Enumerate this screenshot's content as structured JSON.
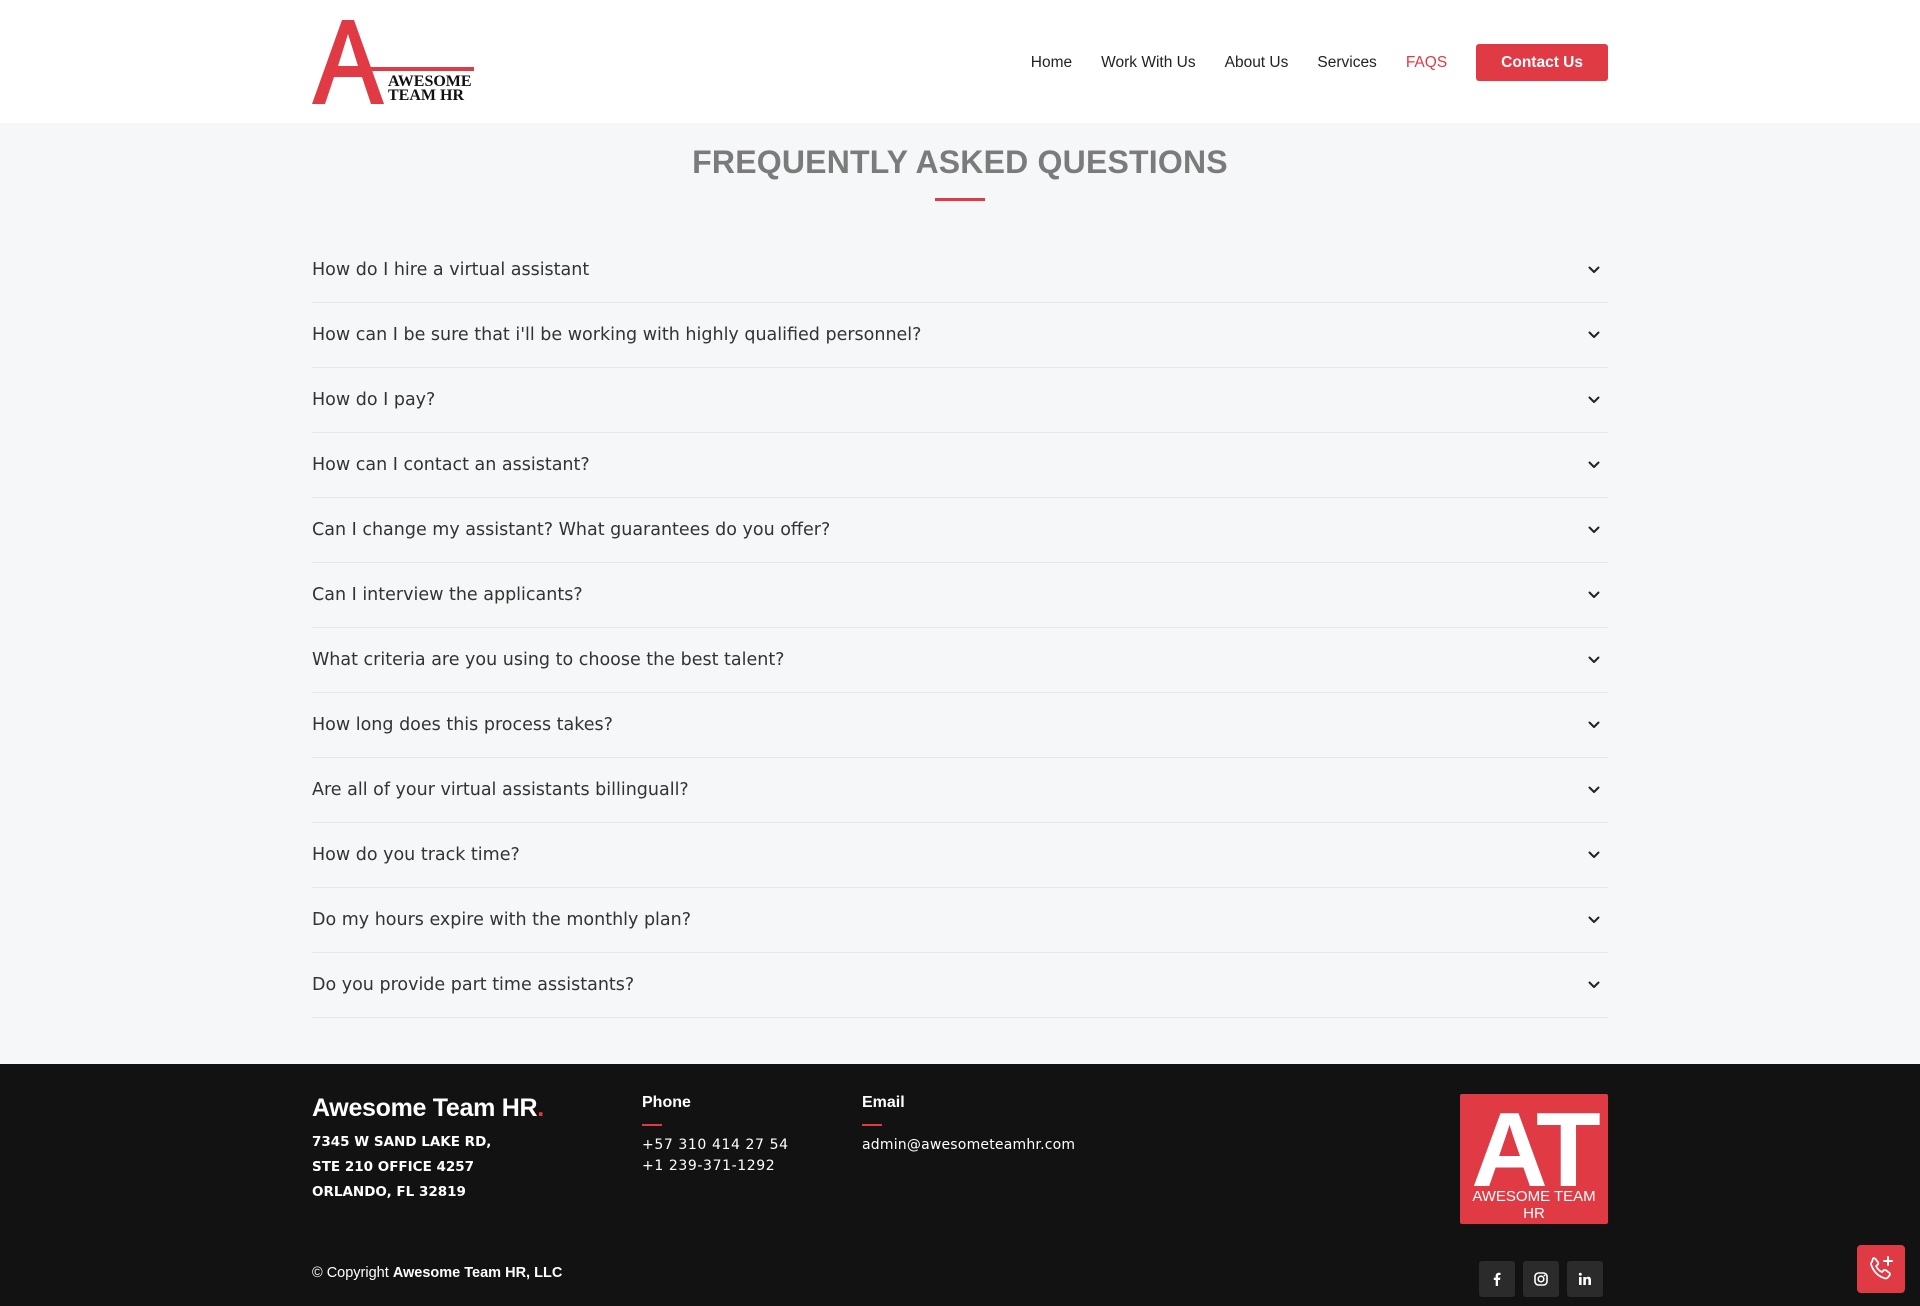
{
  "header": {
    "logo_line1": "AWESOME",
    "logo_line2": "TEAM HR",
    "nav": [
      {
        "label": "Home",
        "active": false
      },
      {
        "label": "Work With Us",
        "active": false
      },
      {
        "label": "About Us",
        "active": false
      },
      {
        "label": "Services",
        "active": false
      },
      {
        "label": "FAQS",
        "active": true
      }
    ],
    "contact_label": "Contact Us"
  },
  "faq": {
    "title": "FREQUENTLY ASKED QUESTIONS",
    "questions": [
      "How do I hire a virtual assistant",
      "How can I be sure that i'll be working with highly qualified personnel?",
      "How do I pay?",
      "How can I contact an assistant?",
      "Can I change my assistant? What guarantees do you offer?",
      "Can I interview the applicants?",
      "What criteria are you using to choose the best talent?",
      "How long does this process takes?",
      "Are all of your virtual assistants billinguall?",
      "How do you track time?",
      "Do my hours expire with the monthly plan?",
      "Do you provide part time assistants?"
    ]
  },
  "footer": {
    "brand": "Awesome Team HR",
    "brand_dot": ".",
    "address": [
      "7345 W SAND LAKE RD,",
      "STE 210 OFFICE 4257",
      "ORLANDO, FL 32819"
    ],
    "phone_heading": "Phone",
    "phones": [
      "+57 310 414 27 54",
      "+1 239-371-1292"
    ],
    "email_heading": "Email",
    "email": "admin@awesometeamhr.com",
    "logo_letters": "AT",
    "logo_text": "AWESOME TEAM HR",
    "copyright_prefix": "© Copyright",
    "copyright_name": "Awesome Team HR, LLC",
    "social_icons": [
      "facebook-icon",
      "instagram-icon",
      "linkedin-icon"
    ]
  },
  "colors": {
    "accent": "#e03a45",
    "footer_bg": "#121212",
    "page_bg": "#f6f7f8",
    "title_gray": "#7b7b7b"
  }
}
